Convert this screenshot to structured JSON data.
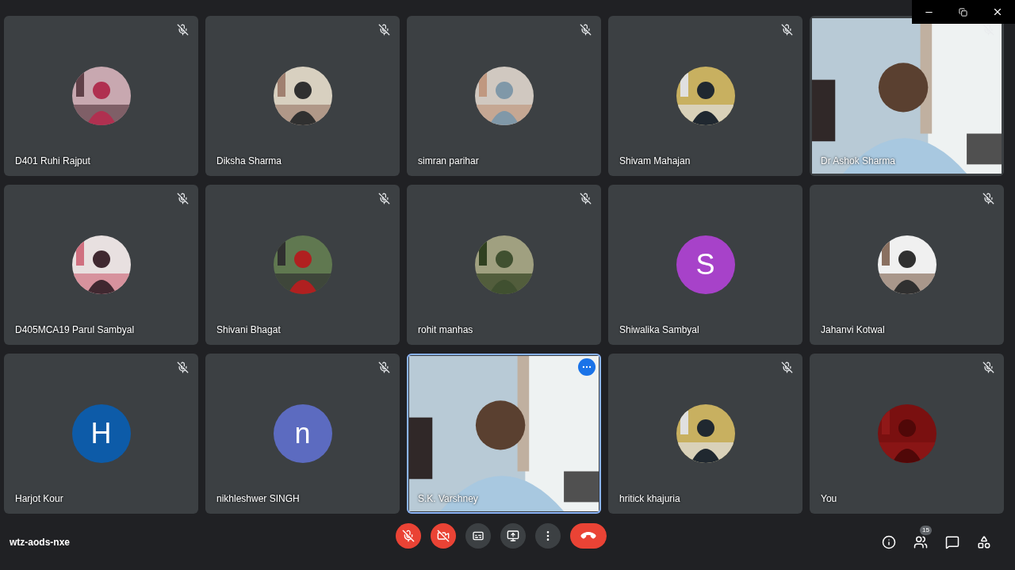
{
  "tiles": [
    {
      "name": "D401 Ruhi Rajput",
      "muted": true,
      "selected": false
    },
    {
      "name": "Diksha Sharma",
      "muted": true,
      "selected": false
    },
    {
      "name": "simran parihar",
      "muted": true,
      "selected": false
    },
    {
      "name": "Shivam Mahajan",
      "muted": true,
      "selected": false
    },
    {
      "name": "Dr Ashok Sharma",
      "kind": "video",
      "muted": true,
      "selected": false
    },
    {
      "name": "D405MCA19 Parul Sambyal",
      "muted": true,
      "selected": false
    },
    {
      "name": "Shivani Bhagat",
      "muted": true,
      "selected": false
    },
    {
      "name": "rohit manhas",
      "muted": true,
      "selected": false
    },
    {
      "name": "Shiwalika Sambyal",
      "kind": "letter",
      "letter": "S",
      "color": "#a742c9",
      "muted": false,
      "selected": false
    },
    {
      "name": "Jahanvi Kotwal",
      "muted": true,
      "selected": false
    },
    {
      "name": "Harjot Kour",
      "kind": "letter",
      "letter": "H",
      "color": "#0d5ba8",
      "muted": true,
      "selected": false
    },
    {
      "name": "nikhleshwer SINGH",
      "kind": "letter",
      "letter": "n",
      "color": "#5c6bc0",
      "muted": true,
      "selected": false
    },
    {
      "name": "S.K. Varshney",
      "kind": "video",
      "muted": false,
      "selected": true
    },
    {
      "name": "hritick khajuria",
      "muted": true,
      "selected": false
    },
    {
      "name": "You",
      "muted": true,
      "selected": false
    }
  ],
  "meeting_code": "wtz-aods-nxe",
  "controls": [
    {
      "kind": "mic",
      "on": false
    },
    {
      "kind": "camera",
      "on": false
    },
    {
      "kind": "captions",
      "on": false
    },
    {
      "kind": "present",
      "on": false
    },
    {
      "kind": "more"
    },
    {
      "kind": "end-call"
    }
  ],
  "participants_count": "15"
}
